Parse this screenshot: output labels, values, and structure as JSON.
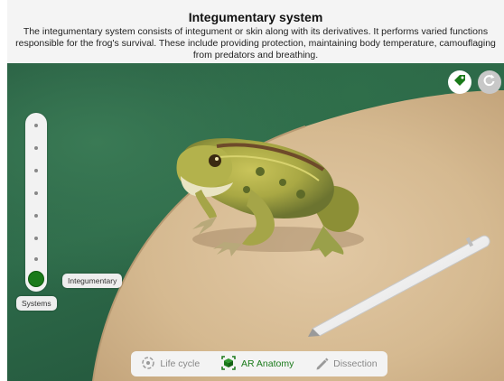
{
  "header": {
    "title": "Integumentary system",
    "description": "The integumentary system consists of integument or skin along with its derivatives. It performs varied functions responsible for the frog's survival. These include providing protection, maintaining body temperature, camouflaging from predators and breathing."
  },
  "toolbar": {
    "tag_icon": "tag-icon",
    "reset_icon": "reset-icon"
  },
  "slider": {
    "levels": 8,
    "selected_level": 8,
    "bottom_label": "Systems",
    "current_label": "Integumentary"
  },
  "tabs": [
    {
      "label": "Life cycle",
      "icon": "life-cycle-icon",
      "active": false
    },
    {
      "label": "AR Anatomy",
      "icon": "ar-cube-icon",
      "active": true
    },
    {
      "label": "Dissection",
      "icon": "pencil-icon",
      "active": false
    }
  ],
  "colors": {
    "accent": "#1a7a1a",
    "carpet": "#2d6a49",
    "table": "#d7bd9a"
  }
}
